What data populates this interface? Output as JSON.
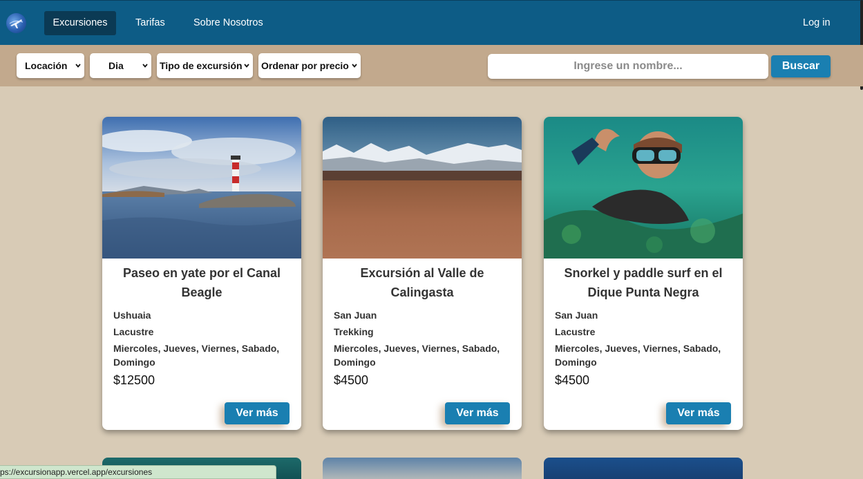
{
  "nav": {
    "items": [
      {
        "label": "Excursiones",
        "active": true
      },
      {
        "label": "Tarifas"
      },
      {
        "label": "Sobre Nosotros"
      }
    ],
    "login_label": "Log in"
  },
  "filters": {
    "location": "Locación",
    "day": "Dia",
    "type": "Tipo de excursión",
    "order": "Ordenar por precio",
    "search_placeholder": "Ingrese un nombre...",
    "search_button": "Buscar"
  },
  "cards": [
    {
      "title": "Paseo en yate por el Canal Beagle",
      "location": "Ushuaia",
      "type": "Lacustre",
      "days": "Miercoles, Jueves, Viernes, Sabado, Domingo",
      "price": "$12500",
      "button": "Ver más"
    },
    {
      "title": "Excursión al Valle de Calingasta",
      "location": "San Juan",
      "type": "Trekking",
      "days": "Miercoles, Jueves, Viernes, Sabado, Domingo",
      "price": "$4500",
      "button": "Ver más"
    },
    {
      "title": "Snorkel y paddle surf en el Dique Punta Negra",
      "location": "San Juan",
      "type": "Lacustre",
      "days": "Miercoles, Jueves, Viernes, Sabado, Domingo",
      "price": "$4500",
      "button": "Ver más"
    }
  ],
  "status_url": "ps://excursionapp.vercel.app/excursiones",
  "colors": {
    "navbar": "#0d5c86",
    "filterbar": "#c2a98d",
    "background": "#d8cbb6",
    "button": "#1a7fb1"
  }
}
